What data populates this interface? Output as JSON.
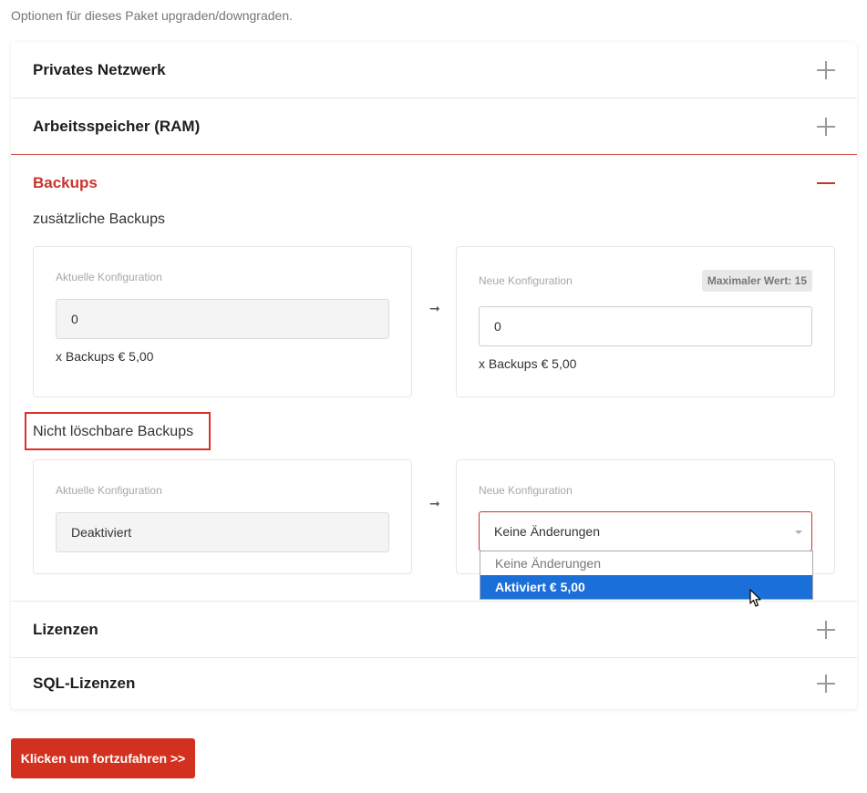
{
  "intro_text": "Optionen für dieses Paket upgraden/downgraden.",
  "accordion": {
    "items": [
      {
        "title": "Privates Netzwerk",
        "state": "collapsed"
      },
      {
        "title": "Arbeitsspeicher (RAM)",
        "state": "collapsed"
      },
      {
        "title": "Backups",
        "state": "expanded"
      },
      {
        "title": "Lizenzen",
        "state": "collapsed"
      },
      {
        "title": "SQL-Lizenzen",
        "state": "collapsed"
      }
    ]
  },
  "backups": {
    "additional": {
      "label": "zusätzliche Backups",
      "current": {
        "label": "Aktuelle Konfiguration",
        "value": "0",
        "note": "x Backups € 5,00"
      },
      "new": {
        "label": "Neue Konfiguration",
        "badge": "Maximaler Wert: 15",
        "value": "0",
        "note": "x Backups € 5,00"
      }
    },
    "non_deletable": {
      "label": "Nicht löschbare Backups",
      "current": {
        "label": "Aktuelle Konfiguration",
        "value": "Deaktiviert"
      },
      "new": {
        "label": "Neue Konfiguration",
        "selected": "Keine Änderungen",
        "options": [
          "Keine Änderungen",
          "Aktiviert € 5,00"
        ],
        "highlighted_option": "Aktiviert € 5,00"
      }
    }
  },
  "continue_button": "Klicken um fortzufahren >>",
  "colors": {
    "accent": "#c8352b",
    "button": "#d3311f",
    "option_highlight": "#1b6fd8"
  },
  "icons": [
    "plus-icon",
    "minus-icon",
    "arrow-right-icon",
    "chevron-down-icon",
    "mouse-cursor-icon"
  ]
}
